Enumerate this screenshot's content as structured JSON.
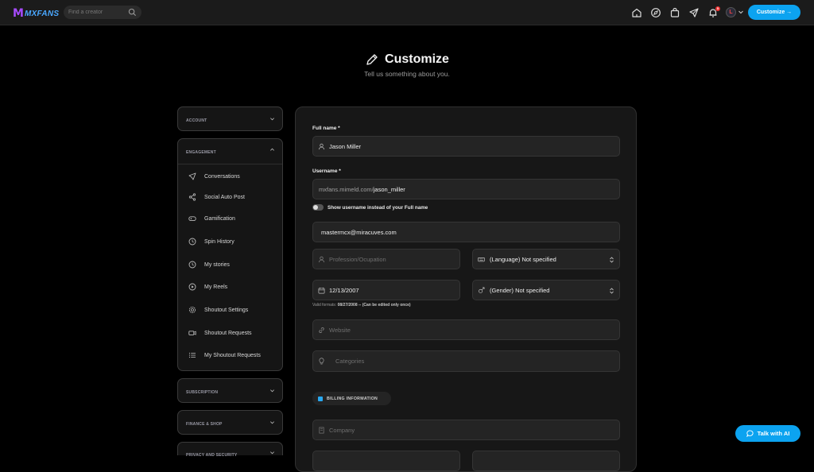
{
  "topbar": {
    "logo_text": "MXFANS",
    "search_placeholder": "Find a creator",
    "notification_count": "5",
    "avatar_letter": "L",
    "customize_label": "Customize →"
  },
  "header": {
    "title": "Customize",
    "subtitle": "Tell us something about you."
  },
  "sidebar": {
    "account": "ACCOUNT",
    "engagement": "ENGAGEMENT",
    "engagement_items": [
      "Conversations",
      "Social Auto Post",
      "Gamification",
      "Spin History",
      "My stories",
      "My Reels",
      "Shoutout Settings",
      "Shoutout Requests",
      "My Shoutout Requests"
    ],
    "subscription": "SUBSCRIPTION",
    "finance": "FINANCE & SHOP",
    "privacy": "PRIVACY AND SECURITY"
  },
  "form": {
    "full_name_label": "Full name *",
    "full_name_value": "Jason Miller",
    "username_label": "Username *",
    "username_prefix": "mxfans.mimeld.com/",
    "username_value": "jason_miller",
    "toggle_label": "Show username instead of your Full name",
    "email_value": "mastermcx@miracuves.com",
    "profession_placeholder": "Profession/Ocupation",
    "language_value": "(Language) Not specified",
    "birthdate_value": "12/13/2007",
    "gender_value": "(Gender) Not specified",
    "hint_prefix": "Valid formats: ",
    "hint_bold": "08/27/2008 -- (Can be edited only once)",
    "website_placeholder": "Website",
    "categories_placeholder": "Categories",
    "billing_label": "BILLING INFORMATION",
    "company_placeholder": "Company"
  },
  "ai_button": "Talk with AI",
  "colors": {
    "accent": "#0ca3f0",
    "background": "#000000",
    "card": "#171717",
    "field": "#242424"
  }
}
